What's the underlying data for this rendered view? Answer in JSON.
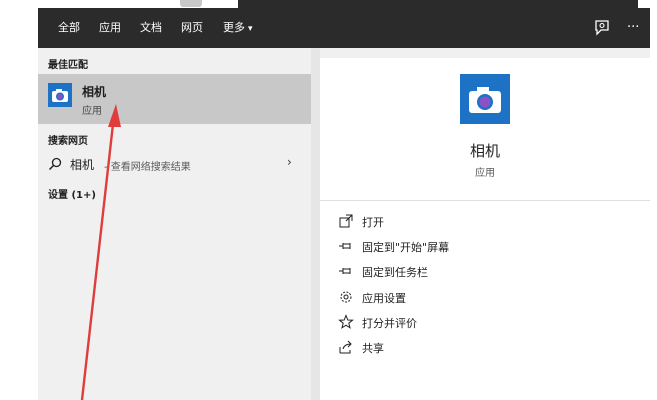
{
  "tabs": [
    {
      "label": "全部"
    },
    {
      "label": "应用"
    },
    {
      "label": "文档"
    },
    {
      "label": "网页"
    },
    {
      "label": "更多"
    }
  ],
  "toolbar": {
    "more_arrow": "▾",
    "feedback_icon": "feedback-icon",
    "ellipsis": "···"
  },
  "left": {
    "best_match_title": "最佳匹配",
    "best_match": {
      "name": "相机",
      "type": "应用",
      "icon": "camera-icon"
    },
    "web_title": "搜索网页",
    "web_result": {
      "term": "相机",
      "hint": "- 查看网络搜索结果",
      "arrow": "›"
    },
    "settings_title": "设置 (1+)"
  },
  "right": {
    "app": {
      "name": "相机",
      "type": "应用",
      "icon": "camera-icon"
    },
    "actions": [
      {
        "label": "打开",
        "icon": "open-icon"
      },
      {
        "label": "固定到\"开始\"屏幕",
        "icon": "pin-icon"
      },
      {
        "label": "固定到任务栏",
        "icon": "pin-icon"
      },
      {
        "label": "应用设置",
        "icon": "gear-icon"
      },
      {
        "label": "打分并评价",
        "icon": "star-icon"
      },
      {
        "label": "共享",
        "icon": "share-icon"
      }
    ]
  },
  "colors": {
    "tabbar": "#2b2b2b",
    "selection": "#c8c8c8",
    "app_tile": "#1d72c6",
    "annotation_arrow": "#e03c3c"
  }
}
